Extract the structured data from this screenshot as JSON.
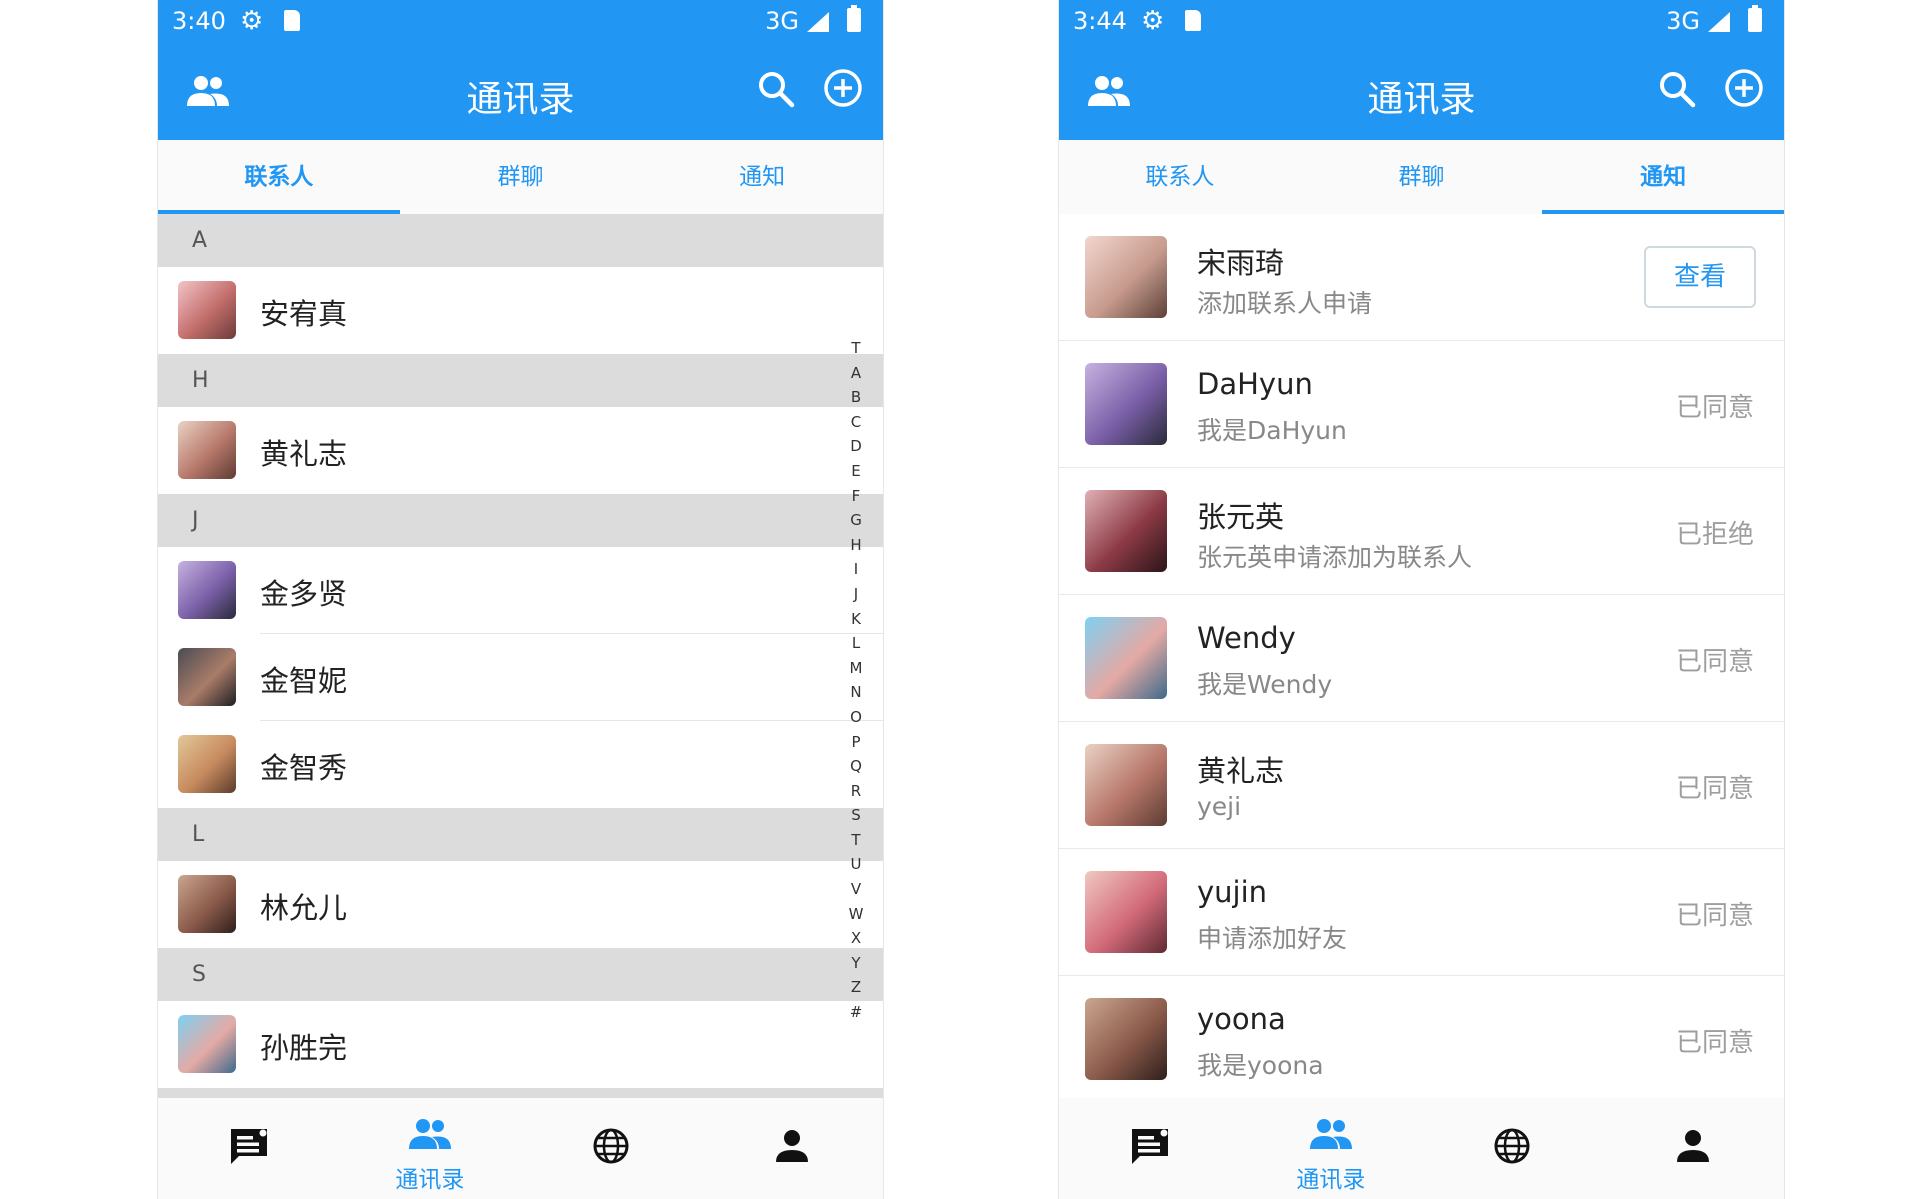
{
  "left_screen": {
    "status_bar": {
      "time": "3:40",
      "network": "3G"
    },
    "app_title": "通讯录",
    "tabs": [
      {
        "label": "联系人",
        "active": true
      },
      {
        "label": "群聊",
        "active": false
      },
      {
        "label": "通知",
        "active": false
      }
    ],
    "sections": [
      {
        "letter": "A",
        "contacts": [
          {
            "name": "安宥真"
          }
        ]
      },
      {
        "letter": "H",
        "contacts": [
          {
            "name": "黄礼志"
          }
        ]
      },
      {
        "letter": "J",
        "contacts": [
          {
            "name": "金多贤"
          },
          {
            "name": "金智妮"
          },
          {
            "name": "金智秀"
          }
        ]
      },
      {
        "letter": "L",
        "contacts": [
          {
            "name": "林允儿"
          }
        ]
      },
      {
        "letter": "S",
        "contacts": [
          {
            "name": "孙胜完"
          }
        ]
      }
    ],
    "index_letters": [
      "T",
      "A",
      "B",
      "C",
      "D",
      "E",
      "F",
      "G",
      "H",
      "I",
      "J",
      "K",
      "L",
      "M",
      "N",
      "O",
      "P",
      "Q",
      "R",
      "S",
      "T",
      "U",
      "V",
      "W",
      "X",
      "Y",
      "Z",
      "#"
    ],
    "bottom_nav": [
      {
        "icon": "chat-icon",
        "label": ""
      },
      {
        "icon": "contacts-icon",
        "label": "通讯录",
        "active": true
      },
      {
        "icon": "globe-icon",
        "label": ""
      },
      {
        "icon": "person-icon",
        "label": ""
      }
    ]
  },
  "right_screen": {
    "status_bar": {
      "time": "3:44",
      "network": "3G"
    },
    "app_title": "通讯录",
    "tabs": [
      {
        "label": "联系人",
        "active": false
      },
      {
        "label": "群聊",
        "active": false
      },
      {
        "label": "通知",
        "active": true
      }
    ],
    "notifications": [
      {
        "name": "宋雨琦",
        "message": "添加联系人申请",
        "action": "查看"
      },
      {
        "name": "DaHyun",
        "message": "我是DaHyun",
        "status": "已同意"
      },
      {
        "name": "张元英",
        "message": "张元英申请添加为联系人",
        "status": "已拒绝"
      },
      {
        "name": "Wendy",
        "message": "我是Wendy",
        "status": "已同意"
      },
      {
        "name": "黄礼志",
        "message": "yeji",
        "status": "已同意"
      },
      {
        "name": "yujin",
        "message": "申请添加好友",
        "status": "已同意"
      },
      {
        "name": "yoona",
        "message": "我是yoona",
        "status": "已同意"
      }
    ],
    "bottom_nav": [
      {
        "icon": "chat-icon",
        "label": ""
      },
      {
        "icon": "contacts-icon",
        "label": "通讯录",
        "active": true
      },
      {
        "icon": "globe-icon",
        "label": ""
      },
      {
        "icon": "person-icon",
        "label": ""
      }
    ]
  },
  "colors": {
    "primary": "#2196f3",
    "section_bg": "#dcdcdc",
    "status_text": "#9e9e9e"
  }
}
